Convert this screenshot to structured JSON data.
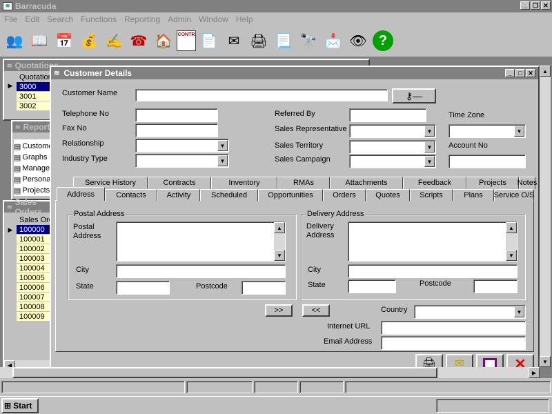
{
  "app": {
    "title": "Barracuda"
  },
  "menu": [
    "File",
    "Edit",
    "Search",
    "Functions",
    "Reporting",
    "Admin",
    "Window",
    "Help"
  ],
  "toolbar_icons": [
    "people-icon",
    "book-icon",
    "calendar-icon",
    "money-bag-icon",
    "write-pen-icon",
    "phone-icon",
    "house-car-icon",
    "contract-icon",
    "letter-icon",
    "envelope-open-icon",
    "printer-icon",
    "document-icon",
    "binoculars-icon",
    "mail-icon",
    "eye-icon",
    "help-icon"
  ],
  "toolbar_contr_label": "CONTR",
  "quotations": {
    "title": "Quotations",
    "col": "Quotation",
    "rows": [
      "3000",
      "3001",
      "3002"
    ]
  },
  "reports": {
    "title": "Reports",
    "items": [
      "Customer",
      "Graphs",
      "Management",
      "Personal",
      "Projects"
    ]
  },
  "sales": {
    "title": "Sales Orders",
    "col": "Sales Order",
    "rows": [
      "100000",
      "100001",
      "100002",
      "100003",
      "100004",
      "100005",
      "100006",
      "100007",
      "100008",
      "100009"
    ]
  },
  "dialog": {
    "title": "Customer Details",
    "labels": {
      "customer_name": "Customer Name",
      "telephone": "Telephone No",
      "fax": "Fax No",
      "relationship": "Relationship",
      "industry": "Industry Type",
      "referred_by": "Referred By",
      "sales_rep": "Sales Representative",
      "sales_territory": "Sales Territory",
      "sales_campaign": "Sales Campaign",
      "time_zone": "Time Zone",
      "account_no": "Account No"
    },
    "tabs_row1": [
      "Service History",
      "Contracts",
      "Inventory",
      "RMAs",
      "Attachments",
      "Feedback",
      "Projects",
      "Notes"
    ],
    "tabs_row2": [
      "Address",
      "Contacts",
      "Activity",
      "Scheduled",
      "Opportunities",
      "Orders",
      "Quotes",
      "Scripts",
      "Plans",
      "Service O/S"
    ],
    "postal": {
      "group": "Postal Address",
      "address": "Postal Address",
      "city": "City",
      "state": "State",
      "postcode": "Postcode"
    },
    "delivery": {
      "group": "Delivery Address",
      "address": "Delivery Address",
      "city": "City",
      "state": "State",
      "postcode": "Postcode"
    },
    "copy_right": ">>",
    "copy_left": "<<",
    "country": "Country",
    "internet_url": "Internet URL",
    "email": "Email Address"
  },
  "taskbar": {
    "start": "Start"
  }
}
